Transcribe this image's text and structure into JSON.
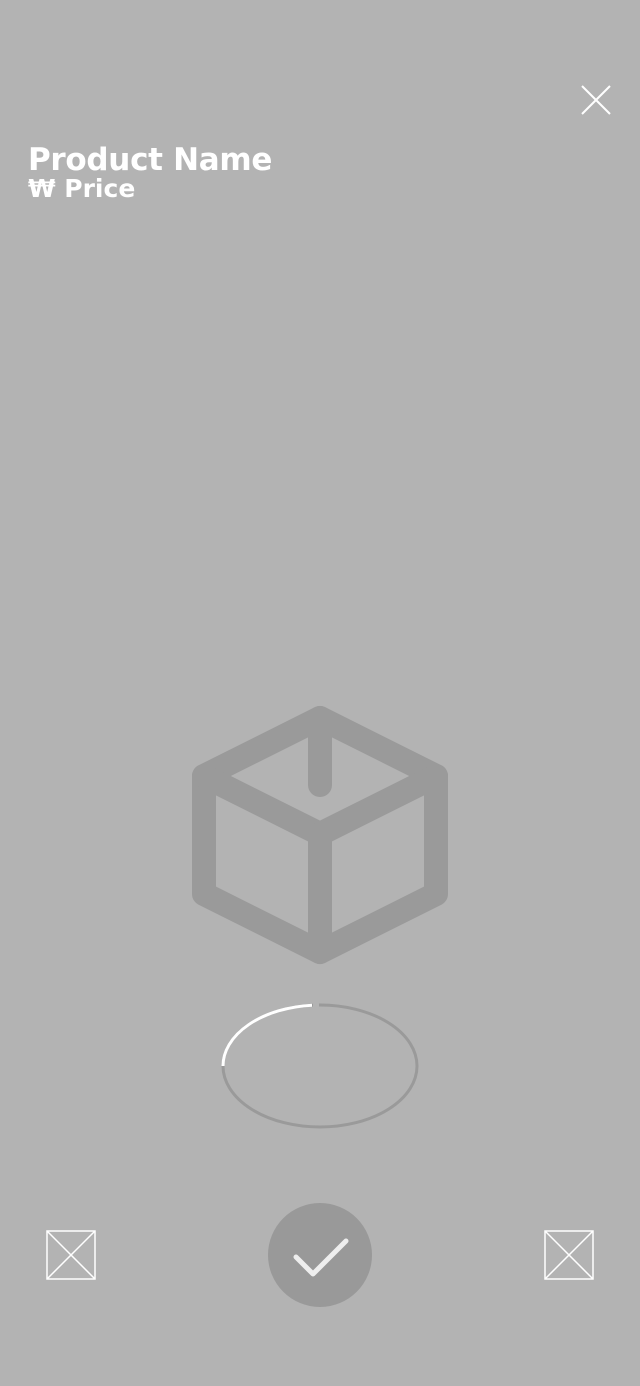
{
  "header": {
    "close_icon": "close-icon"
  },
  "product": {
    "name": "Product Name",
    "price": "₩ Price"
  },
  "viewer": {
    "model_icon": "cube-icon",
    "loading_indicator": "ellipse-progress-ring"
  },
  "bottom_bar": {
    "left_thumbnail_icon": "image-placeholder-icon",
    "confirm_icon": "checkmark-icon",
    "right_thumbnail_icon": "image-placeholder-icon"
  },
  "colors": {
    "background": "#b3b3b3",
    "icon_gray": "#9a9a9a",
    "button_gray": "#999999",
    "text": "#ffffff"
  }
}
